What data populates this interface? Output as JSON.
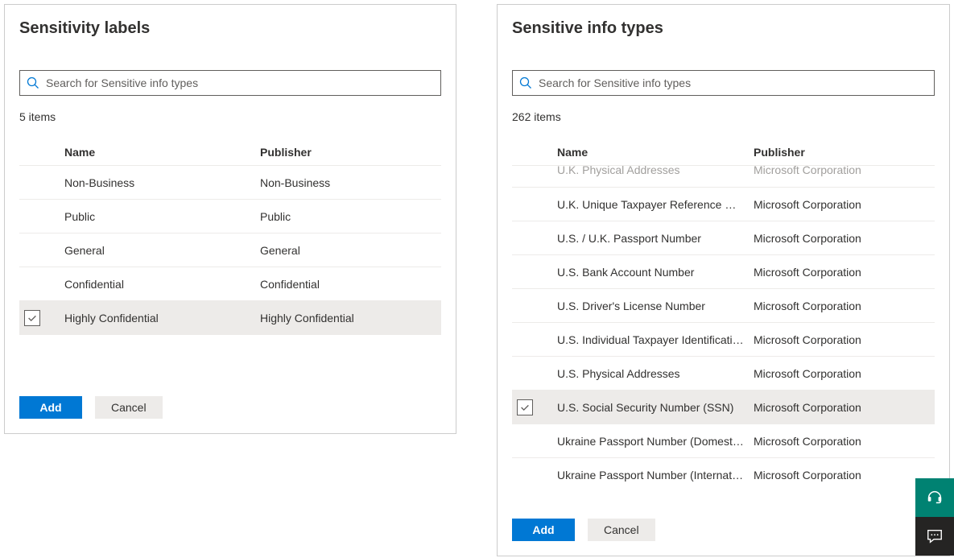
{
  "left": {
    "title": "Sensitivity labels",
    "search_placeholder": "Search for Sensitive info types",
    "item_count": "5 items",
    "headers": {
      "name": "Name",
      "publisher": "Publisher"
    },
    "rows": [
      {
        "name": "Non-Business",
        "publisher": "Non-Business",
        "selected": false
      },
      {
        "name": "Public",
        "publisher": "Public",
        "selected": false
      },
      {
        "name": "General",
        "publisher": "General",
        "selected": false
      },
      {
        "name": "Confidential",
        "publisher": "Confidential",
        "selected": false
      },
      {
        "name": "Highly Confidential",
        "publisher": "Highly Confidential",
        "selected": true
      }
    ],
    "add_label": "Add",
    "cancel_label": "Cancel"
  },
  "right": {
    "title": "Sensitive info types",
    "search_placeholder": "Search for Sensitive info types",
    "item_count": "262 items",
    "headers": {
      "name": "Name",
      "publisher": "Publisher"
    },
    "partial_row": {
      "name": "U.K. Physical Addresses",
      "publisher": "Microsoft Corporation"
    },
    "rows": [
      {
        "name": "U.K. Unique Taxpayer Reference Number",
        "publisher": "Microsoft Corporation",
        "selected": false
      },
      {
        "name": "U.S. / U.K. Passport Number",
        "publisher": "Microsoft Corporation",
        "selected": false
      },
      {
        "name": "U.S. Bank Account Number",
        "publisher": "Microsoft Corporation",
        "selected": false
      },
      {
        "name": "U.S. Driver's License Number",
        "publisher": "Microsoft Corporation",
        "selected": false
      },
      {
        "name": "U.S. Individual Taxpayer Identification N...",
        "publisher": "Microsoft Corporation",
        "selected": false
      },
      {
        "name": "U.S. Physical Addresses",
        "publisher": "Microsoft Corporation",
        "selected": false
      },
      {
        "name": "U.S. Social Security Number (SSN)",
        "publisher": "Microsoft Corporation",
        "selected": true
      },
      {
        "name": "Ukraine Passport Number (Domestic)",
        "publisher": "Microsoft Corporation",
        "selected": false
      },
      {
        "name": "Ukraine Passport Number (International)",
        "publisher": "Microsoft Corporation",
        "selected": false
      }
    ],
    "add_label": "Add",
    "cancel_label": "Cancel"
  }
}
